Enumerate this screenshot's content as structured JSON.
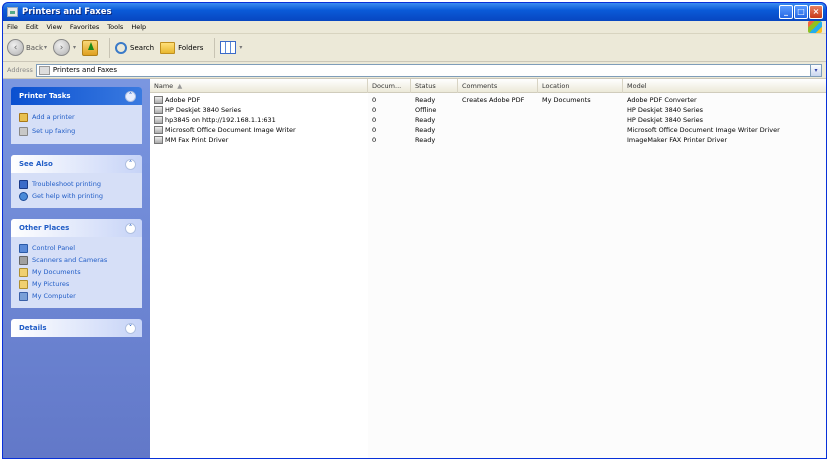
{
  "window": {
    "title": "Printers and Faxes"
  },
  "menu": [
    "File",
    "Edit",
    "View",
    "Favorites",
    "Tools",
    "Help"
  ],
  "toolbar": {
    "back": "Back",
    "search": "Search",
    "folders": "Folders"
  },
  "address": {
    "label": "Address",
    "value": "Printers and Faxes"
  },
  "panels": {
    "printer_tasks": {
      "title": "Printer Tasks",
      "items": [
        "Add a printer",
        "Set up faxing"
      ]
    },
    "see_also": {
      "title": "See Also",
      "items": [
        "Troubleshoot printing",
        "Get help with printing"
      ]
    },
    "other_places": {
      "title": "Other Places",
      "items": [
        "Control Panel",
        "Scanners and Cameras",
        "My Documents",
        "My Pictures",
        "My Computer"
      ]
    },
    "details": {
      "title": "Details"
    }
  },
  "columns": {
    "name": "Name",
    "documents": "Docum...",
    "status": "Status",
    "comments": "Comments",
    "location": "Location",
    "model": "Model"
  },
  "printers": [
    {
      "name": "Adobe PDF",
      "documents": "0",
      "status": "Ready",
      "comments": "Creates Adobe PDF",
      "location": "My Documents",
      "model": "Adobe PDF Converter"
    },
    {
      "name": "HP Deskjet 3840 Series",
      "documents": "0",
      "status": "Offline",
      "comments": "",
      "location": "",
      "model": "HP Deskjet 3840 Series"
    },
    {
      "name": "hp3845 on http://192.168.1.1:631",
      "documents": "0",
      "status": "Ready",
      "comments": "",
      "location": "",
      "model": "HP Deskjet 3840 Series"
    },
    {
      "name": "Microsoft Office Document Image Writer",
      "documents": "0",
      "status": "Ready",
      "comments": "",
      "location": "",
      "model": "Microsoft Office Document Image Writer Driver"
    },
    {
      "name": "MM Fax Print Driver",
      "documents": "0",
      "status": "Ready",
      "comments": "",
      "location": "",
      "model": "ImageMaker FAX Printer Driver"
    }
  ]
}
